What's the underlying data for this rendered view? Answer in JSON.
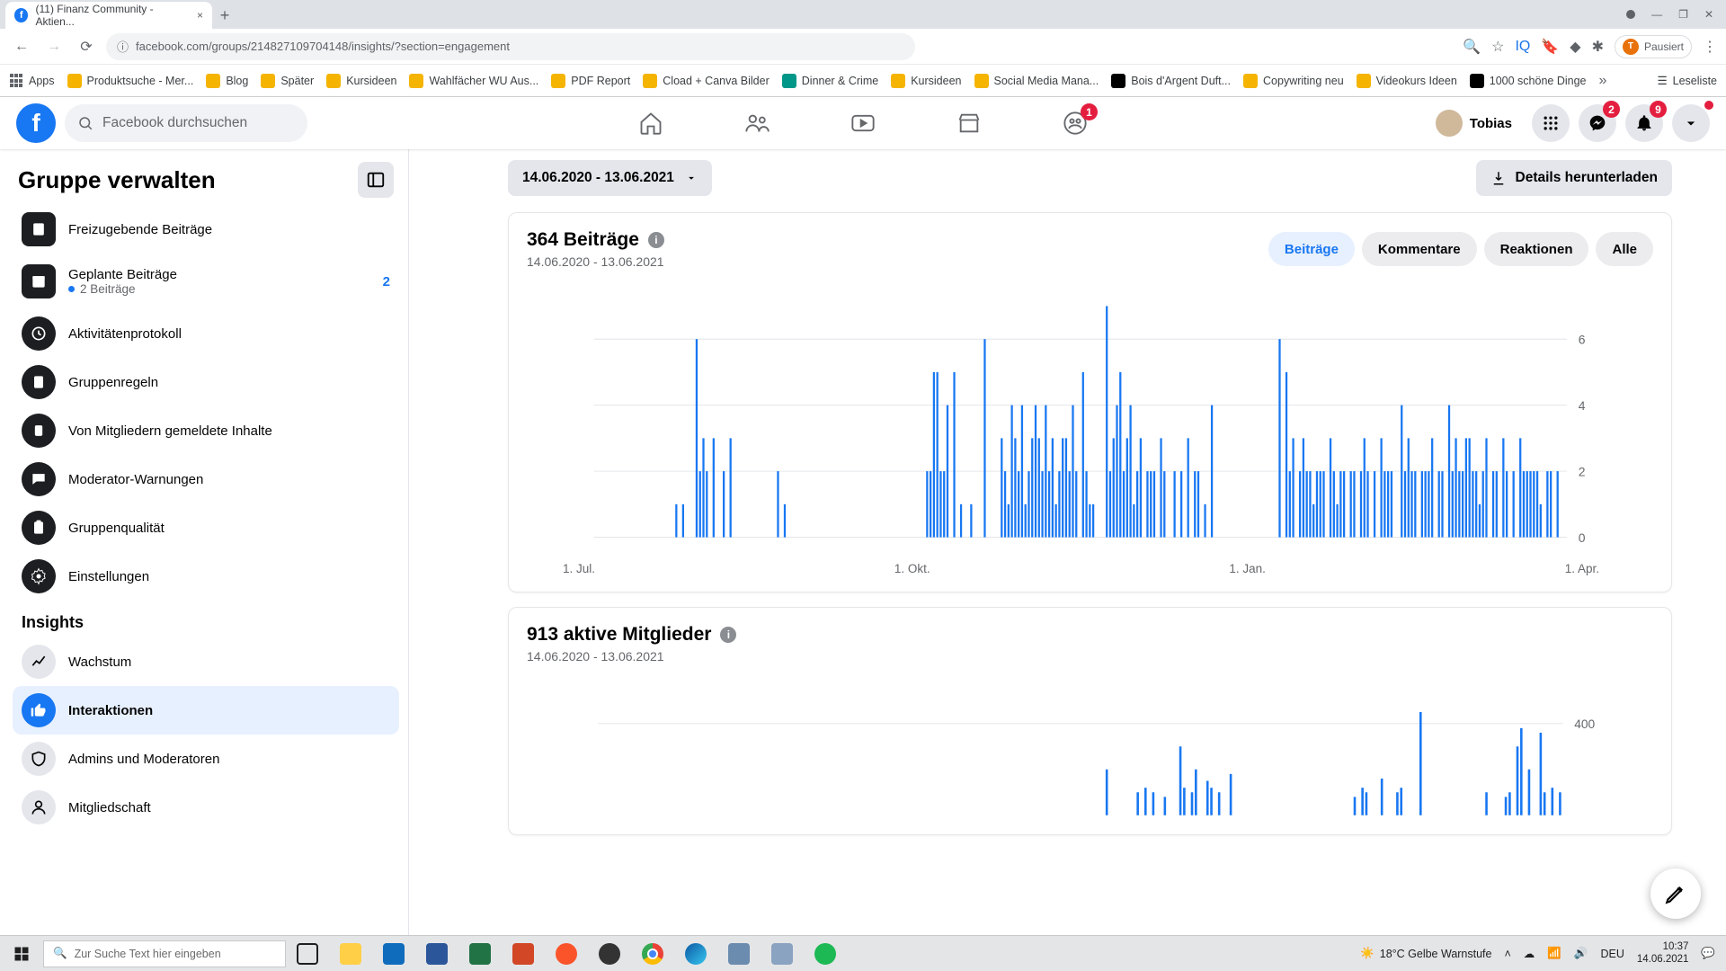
{
  "chrome": {
    "tab_title": "(11) Finanz Community - Aktien...",
    "url": "facebook.com/groups/214827109704148/insights/?section=engagement",
    "minimize": "—",
    "maximize": "❐",
    "close": "✕",
    "reading_list": "Leseliste",
    "paused": "Pausiert",
    "bookmarks": [
      {
        "label": "Apps",
        "color": "#5f6368"
      },
      {
        "label": "Produktsuche - Mer...",
        "color": "#f5b400"
      },
      {
        "label": "Blog",
        "color": "#f5b400"
      },
      {
        "label": "Später",
        "color": "#f5b400"
      },
      {
        "label": "Kursideen",
        "color": "#f5b400"
      },
      {
        "label": "Wahlfächer WU Aus...",
        "color": "#f5b400"
      },
      {
        "label": "PDF Report",
        "color": "#f5b400"
      },
      {
        "label": "Cload + Canva Bilder",
        "color": "#f5b400"
      },
      {
        "label": "Dinner & Crime",
        "color": "#009688"
      },
      {
        "label": "Kursideen",
        "color": "#f5b400"
      },
      {
        "label": "Social Media Mana...",
        "color": "#f5b400"
      },
      {
        "label": "Bois d'Argent Duft...",
        "color": "#000"
      },
      {
        "label": "Copywriting neu",
        "color": "#f5b400"
      },
      {
        "label": "Videokurs Ideen",
        "color": "#f5b400"
      },
      {
        "label": "1000 schöne Dinge",
        "color": "#000"
      }
    ]
  },
  "fb": {
    "search_ph": "Facebook durchsuchen",
    "user_name": "Tobias",
    "badges": {
      "groups": "1",
      "messenger": "2",
      "bell": "9"
    }
  },
  "sidebar": {
    "title": "Gruppe verwalten",
    "pending": "Freizugebende Beiträge",
    "scheduled": "Geplante Beiträge",
    "scheduled_count": "2",
    "scheduled_sub": "2 Beiträge",
    "activity": "Aktivitätenprotokoll",
    "rules": "Gruppenregeln",
    "reported": "Von Mitgliedern gemeldete Inhalte",
    "modwarn": "Moderator-Warnungen",
    "quality": "Gruppenqualität",
    "settings": "Einstellungen",
    "insights_h": "Insights",
    "growth": "Wachstum",
    "interactions": "Interaktionen",
    "admins": "Admins und Moderatoren",
    "membership": "Mitgliedschaft"
  },
  "content": {
    "range": "14.06.2020 - 13.06.2021",
    "download": "Details herunterladen",
    "card1_title": "364 Beiträge",
    "card1_sub": "14.06.2020 - 13.06.2021",
    "card2_title": "913 aktive Mitglieder",
    "card2_sub": "14.06.2020 - 13.06.2021",
    "tabs": [
      "Beiträge",
      "Kommentare",
      "Reaktionen",
      "Alle"
    ],
    "xticks": [
      "1. Jul.",
      "1. Okt.",
      "1. Jan.",
      "1. Apr."
    ],
    "yticks1": [
      "6",
      "4",
      "2",
      "0"
    ],
    "yticks2_400": "400"
  },
  "taskbar": {
    "search_ph": "Zur Suche Text hier eingeben",
    "weather": "18°C  Gelbe Warnstufe",
    "lang": "DEU",
    "time": "10:37",
    "date": "14.06.2021"
  },
  "chart_data": [
    {
      "type": "bar",
      "title": "364 Beiträge",
      "xlabel": "",
      "ylabel": "",
      "ylim": [
        0,
        7
      ],
      "yticks": [
        0,
        2,
        4,
        6
      ],
      "xticks": [
        "1. Jul.",
        "1. Okt.",
        "1. Jan.",
        "1. Apr."
      ],
      "series": [
        {
          "name": "Beiträge",
          "values": [
            0,
            0,
            0,
            0,
            0,
            0,
            0,
            0,
            0,
            0,
            0,
            0,
            0,
            0,
            0,
            0,
            0,
            0,
            0,
            0,
            0,
            0,
            0,
            0,
            1,
            0,
            1,
            0,
            0,
            0,
            6,
            2,
            3,
            2,
            0,
            3,
            0,
            0,
            2,
            0,
            3,
            0,
            0,
            0,
            0,
            0,
            0,
            0,
            0,
            0,
            0,
            0,
            0,
            0,
            2,
            0,
            1,
            0,
            0,
            0,
            0,
            0,
            0,
            0,
            0,
            0,
            0,
            0,
            0,
            0,
            0,
            0,
            0,
            0,
            0,
            0,
            0,
            0,
            0,
            0,
            0,
            0,
            0,
            0,
            0,
            0,
            0,
            0,
            0,
            0,
            0,
            0,
            0,
            0,
            0,
            0,
            0,
            0,
            2,
            2,
            5,
            5,
            2,
            2,
            4,
            0,
            5,
            0,
            1,
            0,
            0,
            1,
            0,
            0,
            0,
            6,
            0,
            0,
            0,
            0,
            3,
            2,
            1,
            4,
            3,
            2,
            4,
            1,
            2,
            3,
            4,
            3,
            2,
            4,
            2,
            3,
            1,
            2,
            3,
            3,
            2,
            4,
            2,
            0,
            5,
            2,
            1,
            1,
            0,
            0,
            0,
            7,
            2,
            3,
            4,
            5,
            2,
            3,
            4,
            1,
            2,
            3,
            0,
            2,
            2,
            2,
            0,
            3,
            2,
            0,
            0,
            2,
            0,
            2,
            0,
            3,
            0,
            2,
            2,
            0,
            1,
            0,
            4,
            0,
            0,
            0,
            0,
            0,
            0,
            0,
            0,
            0,
            0,
            0,
            0,
            0,
            0,
            0,
            0,
            0,
            0,
            0,
            6,
            0,
            5,
            2,
            3,
            0,
            2,
            3,
            2,
            2,
            1,
            2,
            2,
            2,
            0,
            3,
            2,
            1,
            2,
            2,
            0,
            2,
            2,
            0,
            2,
            3,
            2,
            0,
            2,
            0,
            3,
            2,
            2,
            2,
            0,
            0,
            4,
            2,
            3,
            2,
            2,
            0,
            2,
            2,
            2,
            3,
            0,
            2,
            2,
            0,
            4,
            2,
            3,
            2,
            2,
            3,
            3,
            2,
            2,
            1,
            2,
            3,
            0,
            2,
            2,
            0,
            3,
            2,
            0,
            2,
            0,
            3,
            2,
            2,
            2,
            2,
            2,
            1,
            0,
            2,
            2,
            0,
            2,
            0,
            0
          ]
        }
      ]
    },
    {
      "type": "bar",
      "title": "913 aktive Mitglieder",
      "xlabel": "",
      "ylabel": "",
      "ylim": [
        0,
        500
      ],
      "yticks": [
        400
      ],
      "series": [
        {
          "name": "Aktive Mitglieder",
          "values": [
            0,
            0,
            0,
            0,
            0,
            0,
            0,
            0,
            0,
            0,
            0,
            0,
            0,
            0,
            0,
            0,
            0,
            0,
            0,
            0,
            0,
            0,
            0,
            0,
            0,
            0,
            0,
            0,
            0,
            0,
            0,
            0,
            0,
            0,
            0,
            0,
            0,
            0,
            0,
            0,
            0,
            0,
            0,
            0,
            0,
            0,
            0,
            0,
            0,
            0,
            0,
            0,
            0,
            0,
            0,
            0,
            0,
            0,
            0,
            0,
            0,
            0,
            0,
            0,
            0,
            0,
            0,
            0,
            0,
            0,
            0,
            0,
            0,
            0,
            0,
            0,
            0,
            0,
            0,
            0,
            0,
            0,
            0,
            0,
            0,
            0,
            0,
            0,
            0,
            0,
            0,
            0,
            0,
            0,
            0,
            0,
            0,
            0,
            0,
            0,
            0,
            0,
            0,
            0,
            0,
            0,
            0,
            0,
            0,
            0,
            0,
            0,
            0,
            0,
            0,
            0,
            0,
            0,
            0,
            0,
            0,
            0,
            0,
            0,
            0,
            0,
            0,
            0,
            0,
            0,
            0,
            200,
            0,
            0,
            0,
            0,
            0,
            0,
            0,
            100,
            0,
            120,
            0,
            100,
            0,
            0,
            80,
            0,
            0,
            0,
            300,
            120,
            0,
            100,
            200,
            0,
            0,
            150,
            120,
            0,
            100,
            0,
            0,
            180,
            0,
            0,
            0,
            0,
            0,
            0,
            0,
            0,
            0,
            0,
            0,
            0,
            0,
            0,
            0,
            0,
            0,
            0,
            0,
            0,
            0,
            0,
            0,
            0,
            0,
            0,
            0,
            0,
            0,
            0,
            0,
            80,
            0,
            120,
            100,
            0,
            0,
            0,
            160,
            0,
            0,
            0,
            100,
            120,
            0,
            0,
            0,
            0,
            450,
            0,
            0,
            0,
            0,
            0,
            0,
            0,
            0,
            0,
            0,
            0,
            0,
            0,
            0,
            0,
            0,
            100,
            0,
            0,
            0,
            0,
            80,
            100,
            0,
            300,
            380,
            0,
            200,
            0,
            0,
            360,
            100,
            0,
            120,
            0,
            100
          ]
        }
      ]
    }
  ]
}
